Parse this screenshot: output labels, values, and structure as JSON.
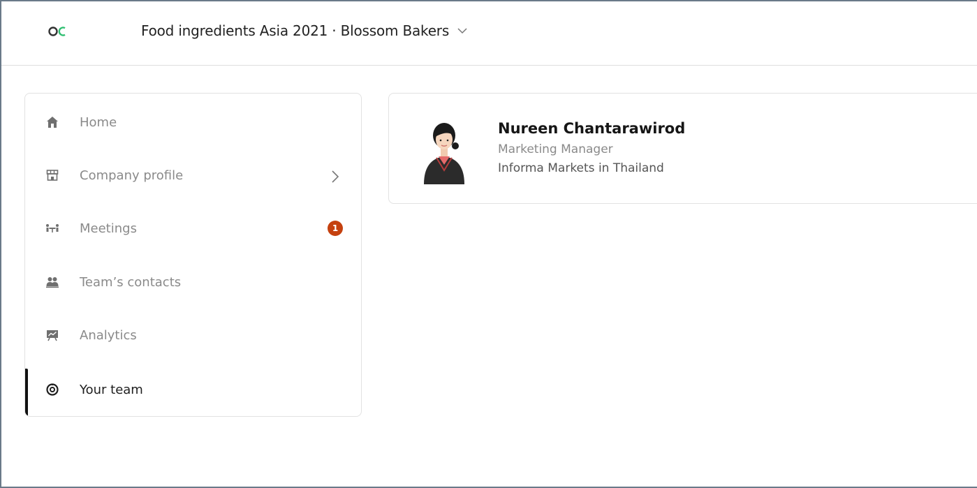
{
  "header": {
    "logo_text": "OC",
    "event_title": "Food ingredients Asia 2021 · Blossom Bakers"
  },
  "sidebar": {
    "items": [
      {
        "label": "Home",
        "icon": "home-icon"
      },
      {
        "label": "Company profile",
        "icon": "storefront-icon",
        "has_arrow": true
      },
      {
        "label": "Meetings",
        "icon": "meeting-table-icon",
        "badge": "1"
      },
      {
        "label": "Team’s contacts",
        "icon": "contacts-group-icon"
      },
      {
        "label": "Analytics",
        "icon": "analytics-board-icon"
      },
      {
        "label": "Your team",
        "icon": "team-settings-icon",
        "active": true
      }
    ]
  },
  "person": {
    "name": "Nureen Chantarawirod",
    "role": "Marketing Manager",
    "company": "Informa Markets in Thailand"
  },
  "colors": {
    "badge": "#c5410f",
    "logo_green": "#2fbf71",
    "active_bar": "#111111",
    "muted_text": "#8a8a8a"
  }
}
